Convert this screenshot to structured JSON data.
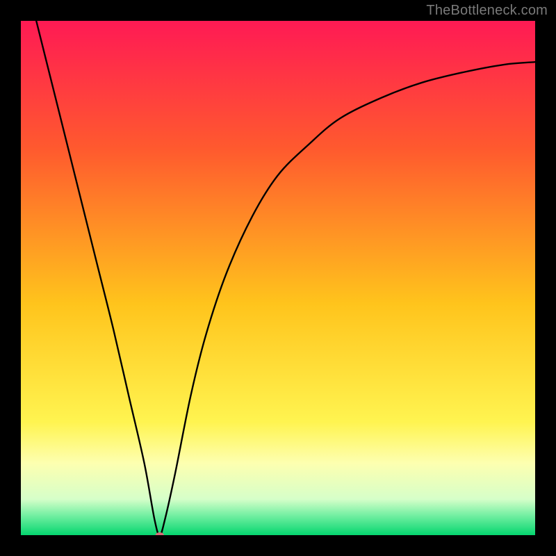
{
  "attribution": "TheBottleneck.com",
  "chart_data": {
    "type": "line",
    "title": "",
    "xlabel": "",
    "ylabel": "",
    "xlim": [
      0,
      100
    ],
    "ylim": [
      0,
      100
    ],
    "background_gradient": {
      "stops": [
        {
          "pct": 0,
          "color": "#ff1a54"
        },
        {
          "pct": 25,
          "color": "#ff5a2e"
        },
        {
          "pct": 55,
          "color": "#ffc41c"
        },
        {
          "pct": 78,
          "color": "#fff450"
        },
        {
          "pct": 86,
          "color": "#fdffb0"
        },
        {
          "pct": 93,
          "color": "#d6ffc9"
        },
        {
          "pct": 96,
          "color": "#78f0a4"
        },
        {
          "pct": 100,
          "color": "#05d66f"
        }
      ]
    },
    "curve": {
      "description": "V-shaped curve reaching 0 near x≈27 then rising with diminishing slope toward the right",
      "notch_x": 27,
      "points": [
        {
          "x": 3,
          "y": 100
        },
        {
          "x": 6,
          "y": 88
        },
        {
          "x": 9,
          "y": 76
        },
        {
          "x": 12,
          "y": 64
        },
        {
          "x": 15,
          "y": 52
        },
        {
          "x": 18,
          "y": 40
        },
        {
          "x": 21,
          "y": 27
        },
        {
          "x": 24,
          "y": 14
        },
        {
          "x": 26,
          "y": 3
        },
        {
          "x": 27,
          "y": 0
        },
        {
          "x": 28,
          "y": 3
        },
        {
          "x": 30,
          "y": 12
        },
        {
          "x": 33,
          "y": 27
        },
        {
          "x": 36,
          "y": 39
        },
        {
          "x": 40,
          "y": 51
        },
        {
          "x": 45,
          "y": 62
        },
        {
          "x": 50,
          "y": 70
        },
        {
          "x": 56,
          "y": 76
        },
        {
          "x": 62,
          "y": 81
        },
        {
          "x": 70,
          "y": 85
        },
        {
          "x": 78,
          "y": 88
        },
        {
          "x": 86,
          "y": 90
        },
        {
          "x": 94,
          "y": 91.5
        },
        {
          "x": 100,
          "y": 92
        }
      ]
    },
    "marker": {
      "x": 27,
      "y": 0,
      "rx": 6,
      "ry": 4,
      "color": "#d86d78"
    }
  }
}
